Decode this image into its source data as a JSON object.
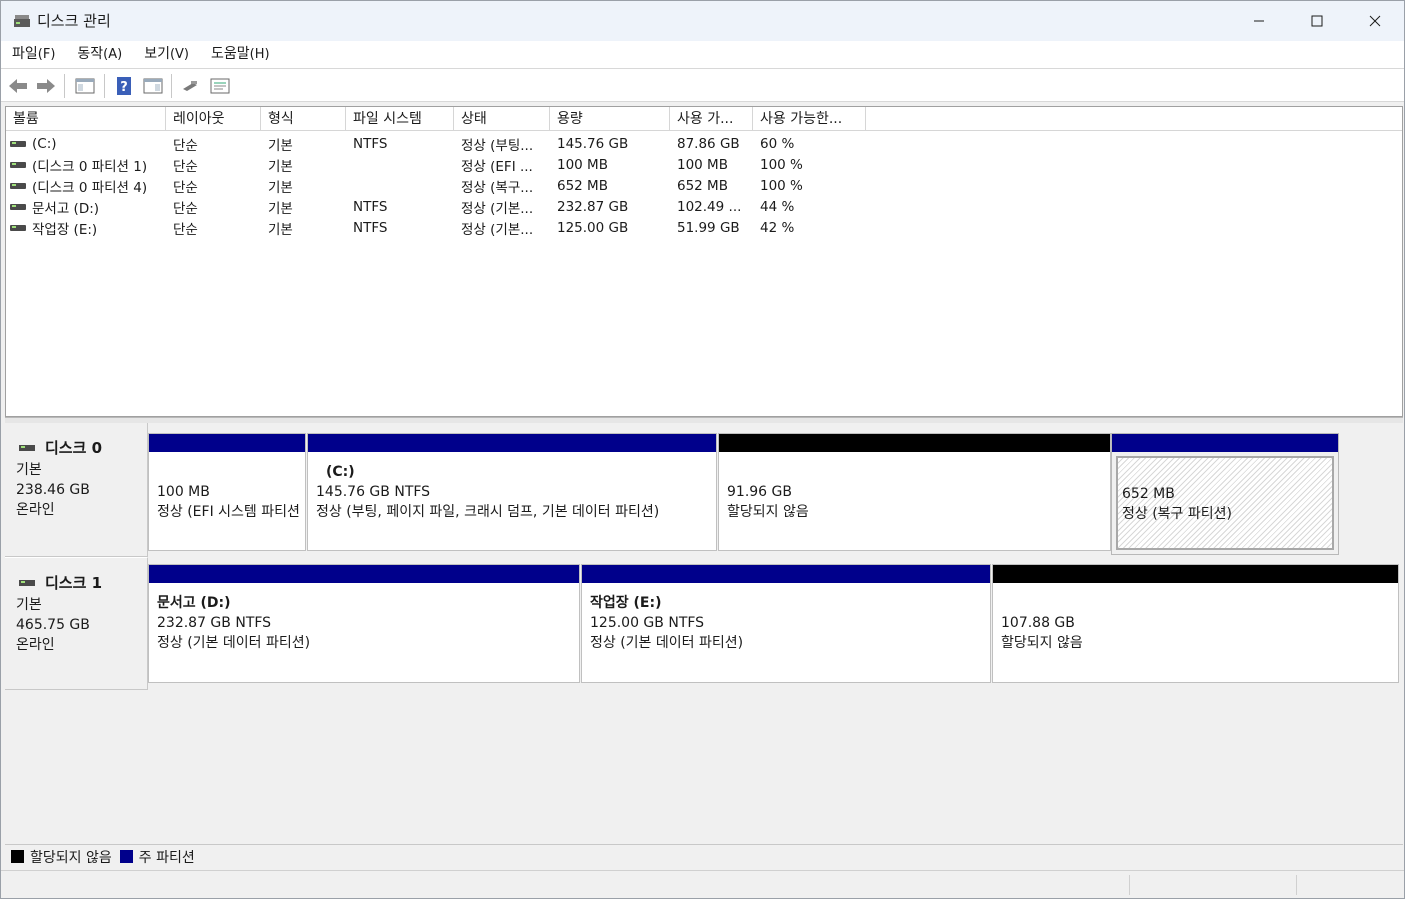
{
  "window": {
    "title": "디스크 관리"
  },
  "menu": [
    {
      "label": "파일",
      "acc": "(F)"
    },
    {
      "label": "동작",
      "acc": "(A)"
    },
    {
      "label": "보기",
      "acc": "(V)"
    },
    {
      "label": "도움말",
      "acc": "(H)"
    }
  ],
  "toolbar": [
    "back-arrow-icon",
    "forward-arrow-icon",
    "console-tree-icon",
    "help-icon",
    "action-pane-icon",
    "connect-icon",
    "properties-icon"
  ],
  "list": {
    "columns": [
      "볼륨",
      "레이아웃",
      "형식",
      "파일 시스템",
      "상태",
      "용량",
      "사용 가...",
      "사용 가능한..."
    ],
    "rows": [
      {
        "volume": "(C:)",
        "layout": "단순",
        "type": "기본",
        "fs": "NTFS",
        "status": "정상 (부팅...",
        "capacity": "145.76 GB",
        "free": "87.86 GB",
        "pct": "60 %"
      },
      {
        "volume": "(디스크 0 파티션 1)",
        "layout": "단순",
        "type": "기본",
        "fs": "",
        "status": "정상 (EFI ...",
        "capacity": "100 MB",
        "free": "100 MB",
        "pct": "100 %"
      },
      {
        "volume": "(디스크 0 파티션 4)",
        "layout": "단순",
        "type": "기본",
        "fs": "",
        "status": "정상 (복구...",
        "capacity": "652 MB",
        "free": "652 MB",
        "pct": "100 %"
      },
      {
        "volume": "문서고 (D:)",
        "layout": "단순",
        "type": "기본",
        "fs": "NTFS",
        "status": "정상 (기본...",
        "capacity": "232.87 GB",
        "free": "102.49 ...",
        "pct": "44 %"
      },
      {
        "volume": "작업장 (E:)",
        "layout": "단순",
        "type": "기본",
        "fs": "NTFS",
        "status": "정상 (기본...",
        "capacity": "125.00 GB",
        "free": "51.99 GB",
        "pct": "42 %"
      }
    ]
  },
  "disks": [
    {
      "name": "디스크 0",
      "type": "기본",
      "size": "238.46 GB",
      "state": "온라인",
      "partitions": [
        {
          "name": "",
          "size": "100 MB",
          "status": "정상 (EFI 시스템 파티션)",
          "kind": "primary"
        },
        {
          "name": "(C:)",
          "size": "145.76 GB NTFS",
          "status": "정상 (부팅, 페이지 파일, 크래시 덤프, 기본 데이터 파티션)",
          "kind": "primary"
        },
        {
          "name": "",
          "size": "91.96 GB",
          "status": "할당되지 않음",
          "kind": "unallocated"
        },
        {
          "name": "",
          "size": "652 MB",
          "status": "정상 (복구 파티션)",
          "kind": "primary-selected"
        }
      ]
    },
    {
      "name": "디스크 1",
      "type": "기본",
      "size": "465.75 GB",
      "state": "온라인",
      "partitions": [
        {
          "name": "문서고  (D:)",
          "size": "232.87 GB NTFS",
          "status": "정상 (기본 데이터 파티션)",
          "kind": "primary"
        },
        {
          "name": "작업장  (E:)",
          "size": "125.00 GB NTFS",
          "status": "정상 (기본 데이터 파티션)",
          "kind": "primary"
        },
        {
          "name": "",
          "size": "107.88 GB",
          "status": "할당되지 않음",
          "kind": "unallocated"
        }
      ]
    }
  ],
  "legend": [
    {
      "label": "할당되지 않음",
      "color": "#000000"
    },
    {
      "label": "주 파티션",
      "color": "#00008b"
    }
  ]
}
